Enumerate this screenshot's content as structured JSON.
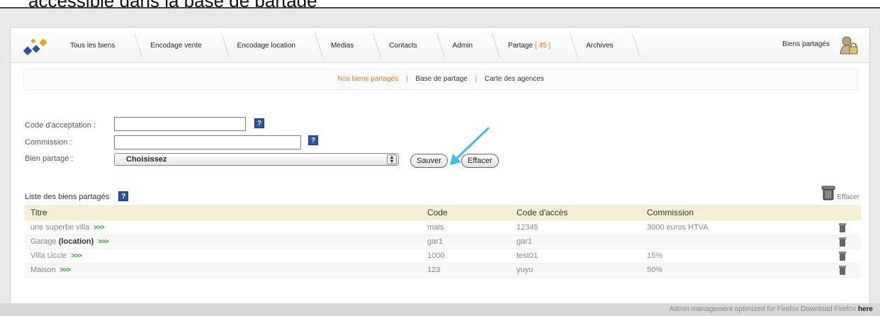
{
  "caption": "accessible dans la base de partage",
  "nav": {
    "items": [
      {
        "label": "Tous les biens"
      },
      {
        "label": "Encodage vente"
      },
      {
        "label": "Encodage location"
      },
      {
        "label": "Medias"
      },
      {
        "label": "Contacts"
      },
      {
        "label": "Admin"
      },
      {
        "label": "Partage",
        "count": "[ 45 ]"
      },
      {
        "label": "Archives"
      }
    ],
    "right_label": "Biens partagés"
  },
  "subnav": {
    "items": [
      "Nos biens partagés",
      "Base de partage",
      "Carte des agences"
    ],
    "sep": "|"
  },
  "form": {
    "code_label": "Code d'acceptation :",
    "commission_label": "Commission :",
    "bien_label": "Bien partagé :",
    "select_value": "Choisissez",
    "save": "Sauver",
    "clear": "Effacer",
    "help": "?"
  },
  "list": {
    "title": "Liste des biens partagés",
    "clear_label": "Effacer",
    "columns": [
      "Titre",
      "Code",
      "Code d'accès",
      "Commission"
    ],
    "more": ">>>",
    "rows": [
      {
        "title": "une superbe villa",
        "loc": "",
        "code": "mais",
        "access": "12345",
        "commission": "3000 euros HTVA"
      },
      {
        "title": "Garage",
        "loc": "(location)",
        "code": "gar1",
        "access": "gar1",
        "commission": ""
      },
      {
        "title": "Villa Uccle",
        "loc": "",
        "code": "1000",
        "access": "test01",
        "commission": "15%"
      },
      {
        "title": "Maison",
        "loc": "",
        "code": "123",
        "access": "yuyu",
        "commission": "50%"
      }
    ]
  },
  "footer": {
    "text": "Admin management optimized for Firefox   Download Firefox",
    "link": "here"
  },
  "colors": {
    "accent": "#e07a1f",
    "help_blue": "#2a54a8",
    "more_green": "#2c9a2c",
    "arrow": "#45b8e8"
  }
}
